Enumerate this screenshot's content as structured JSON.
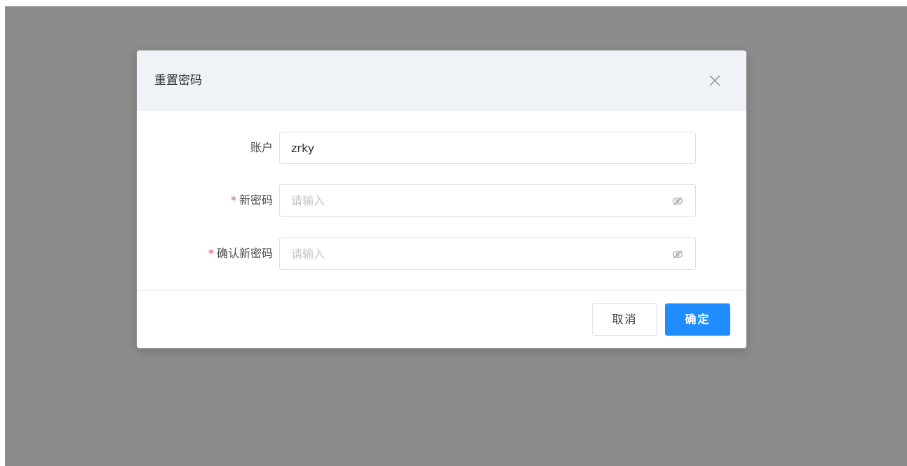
{
  "dialog": {
    "title": "重置密码",
    "close_icon": "close-icon"
  },
  "form": {
    "account": {
      "label": "账户",
      "value": "zrky",
      "required": false
    },
    "new_password": {
      "label": "新密码",
      "required_mark": "*",
      "placeholder": "请输入",
      "value": "",
      "toggle_icon": "eye-hidden-icon"
    },
    "confirm_password": {
      "label": "确认新密码",
      "required_mark": "*",
      "placeholder": "请输入",
      "value": "",
      "toggle_icon": "eye-hidden-icon"
    }
  },
  "footer": {
    "cancel_label": "取消",
    "confirm_label": "确定"
  },
  "colors": {
    "overlay": "#8c8c8c",
    "header_bg": "#eff2f6",
    "primary": "#1f8dff",
    "required": "#f04b4b"
  }
}
